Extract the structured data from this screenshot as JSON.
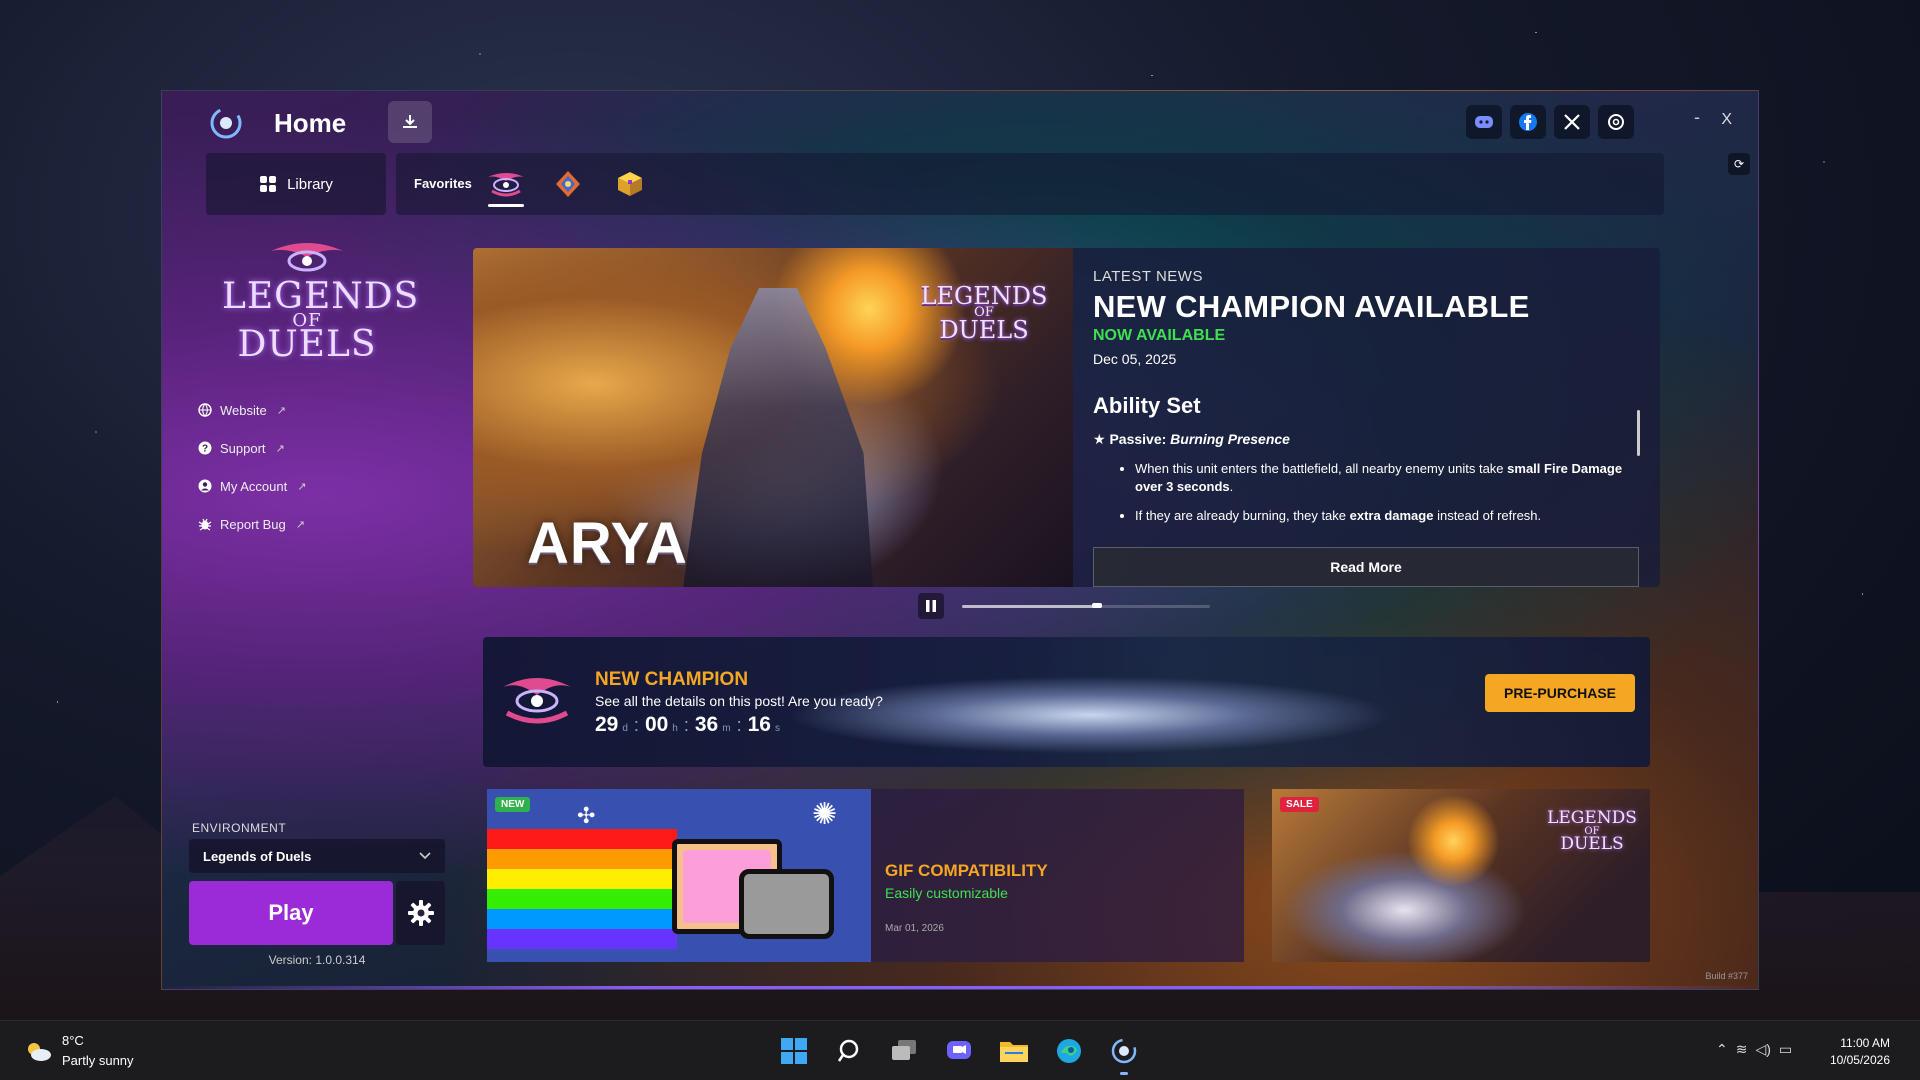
{
  "window": {
    "title": "Home",
    "minimize_label": "-",
    "close_label": "X",
    "social": [
      "discord-icon",
      "facebook-icon",
      "x-icon",
      "threads-icon"
    ],
    "build": "Build #377"
  },
  "nav": {
    "library_label": "Library",
    "favorites_label": "Favorites",
    "favorites": [
      "legends-of-duels-icon",
      "rune-game-icon",
      "cube-game-icon"
    ]
  },
  "sidebar": {
    "logo": {
      "line1": "LEGENDS",
      "line2": "OF",
      "line3": "DUELS"
    },
    "links": [
      {
        "label": "Website",
        "icon": "globe-icon"
      },
      {
        "label": "Support",
        "icon": "help-icon"
      },
      {
        "label": "My Account",
        "icon": "account-icon"
      },
      {
        "label": "Report Bug",
        "icon": "bug-icon"
      }
    ],
    "environment_label": "ENVIRONMENT",
    "environment_value": "Legends of Duels",
    "play_label": "Play",
    "version": "Version: 1.0.0.314"
  },
  "news": {
    "image_title": "ARYA",
    "kicker": "LATEST NEWS",
    "title": "NEW CHAMPION AVAILABLE",
    "status": "NOW AVAILABLE",
    "date": "Dec 05, 2025",
    "section_title": "Ability Set",
    "passive_prefix": "★ Passive: ",
    "passive_name": "Burning Presence",
    "bullet1_a": "When this unit enters the battlefield, all nearby enemy units take ",
    "bullet1_b": "small Fire Damage over 3 seconds",
    "bullet1_c": ".",
    "bullet2_a": "If they are already burning, they take ",
    "bullet2_b": "extra damage",
    "bullet2_c": " instead of refresh.",
    "read_more": "Read More",
    "carousel_progress": 0.55
  },
  "banner": {
    "title": "NEW CHAMPION",
    "subtitle": "See all the details on this post! Are you ready?",
    "countdown": {
      "d": "29",
      "h": "00",
      "m": "36",
      "s": "16"
    },
    "units": {
      "d": "d",
      "h": "h",
      "m": "m",
      "s": "s"
    },
    "cta": "PRE-PURCHASE"
  },
  "cards": {
    "gif": {
      "badge": "NEW",
      "title": "GIF COMPATIBILITY",
      "subtitle": "Easily customizable",
      "date": "Mar 01, 2026"
    },
    "sale": {
      "badge": "SALE"
    }
  },
  "taskbar": {
    "temperature": "8°C",
    "weather": "Partly sunny",
    "time": "11:00 AM",
    "date": "10/05/2026"
  }
}
